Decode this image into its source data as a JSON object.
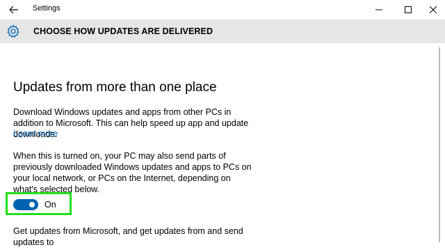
{
  "window": {
    "title": "Settings"
  },
  "header": {
    "title": "CHOOSE HOW UPDATES ARE DELIVERED",
    "icon": "gear-icon"
  },
  "section": {
    "heading": "Updates from more than one place",
    "description": "Download Windows updates and apps from other PCs in addition to Microsoft. This can help speed up app and update downloads.",
    "learn_more": "Learn more",
    "detail": "When this is turned on, your PC may also send parts of previously downloaded Windows updates and apps to PCs on your local network, or PCs on the Internet, depending on what's selected below.",
    "toggle": {
      "state": "On",
      "is_on": true
    },
    "source_prompt": "Get updates from Microsoft, and get updates from and send updates to"
  },
  "colors": {
    "accent": "#0063b1",
    "header_bg": "#e6e6e6",
    "highlight": "#22e11c"
  }
}
